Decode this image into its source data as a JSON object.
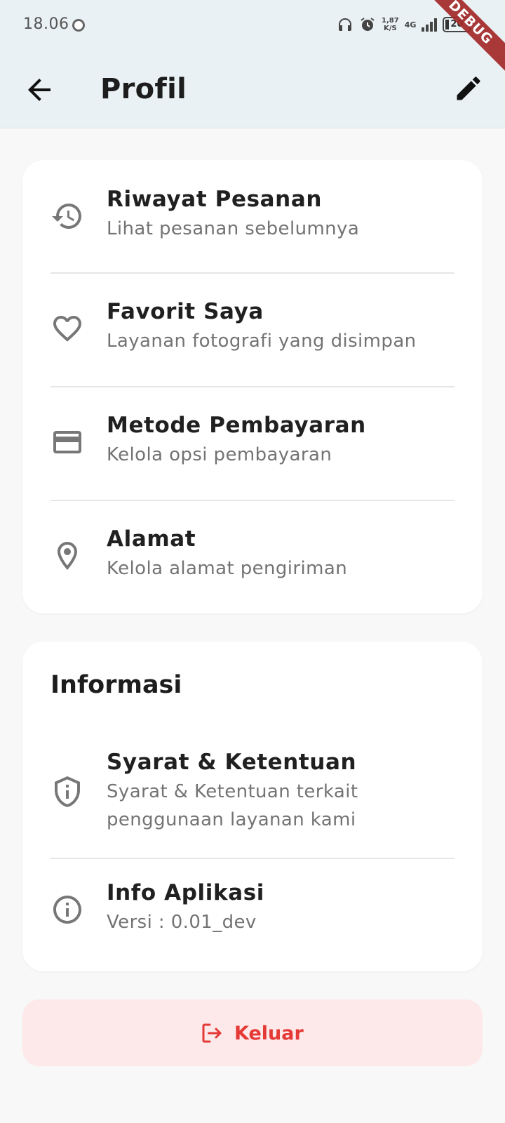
{
  "status_bar": {
    "time": "18.06",
    "speed_value": "1,87",
    "speed_unit": "K/S",
    "network": "4G",
    "battery": "20",
    "debug_banner": "DEBUG"
  },
  "appbar": {
    "title": "Profil",
    "back_icon": "arrow-back-icon",
    "edit_icon": "pencil-icon"
  },
  "menu": {
    "items": [
      {
        "title": "Riwayat Pesanan",
        "subtitle": "Lihat pesanan sebelumnya",
        "icon": "history-icon"
      },
      {
        "title": "Favorit Saya",
        "subtitle": "Layanan fotografi yang disimpan",
        "icon": "heart-icon"
      },
      {
        "title": "Metode Pembayaran",
        "subtitle": "Kelola opsi pembayaran",
        "icon": "credit-card-icon"
      },
      {
        "title": "Alamat",
        "subtitle": "Kelola alamat pengiriman",
        "icon": "location-pin-icon"
      }
    ]
  },
  "info": {
    "title": "Informasi",
    "items": [
      {
        "title": "Syarat & Ketentuan",
        "subtitle": "Syarat & Ketentuan terkait penggunaan layanan kami",
        "icon": "shield-info-icon"
      },
      {
        "title": "Info Aplikasi",
        "subtitle": "Versi : 0.01_dev",
        "icon": "info-icon"
      }
    ]
  },
  "logout": {
    "label": "Keluar",
    "icon": "logout-icon",
    "color": "#e53935",
    "background": "#fde8ea"
  },
  "colors": {
    "appbar_bg": "#e9f1f4",
    "page_bg": "#f8f8f8",
    "card_bg": "#ffffff",
    "icon_gray": "#777777"
  }
}
